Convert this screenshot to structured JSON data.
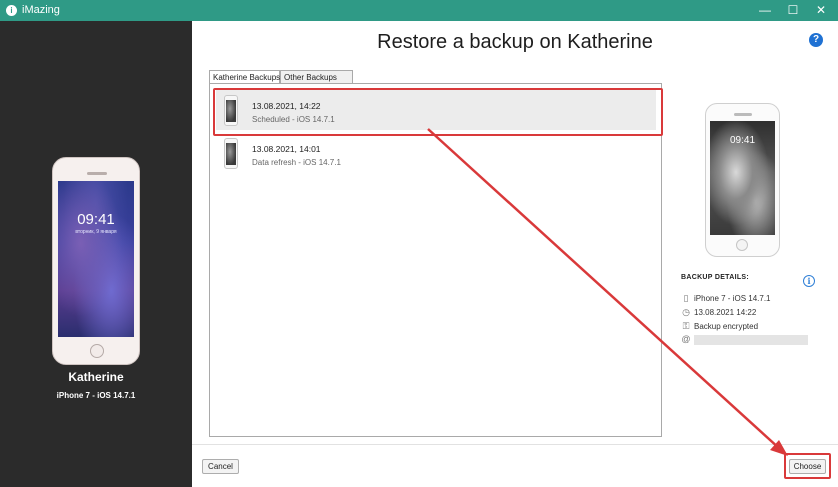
{
  "window": {
    "title": "iMazing",
    "app_icon_glyph": "i",
    "minimize": "—",
    "maximize": "☐",
    "close": "✕"
  },
  "device": {
    "name": "Katherine",
    "info": "iPhone 7 - iOS 14.7.1",
    "lock_time": "09:41",
    "lock_date": "вторник, 9 января"
  },
  "dialog": {
    "title": "Restore a backup on Katherine",
    "help_glyph": "?",
    "tabs": [
      {
        "label": "Katherine Backups",
        "active": true
      },
      {
        "label": "Other Backups",
        "active": false
      }
    ],
    "backups": [
      {
        "date": "13.08.2021, 14:22",
        "subtitle": "Scheduled - iOS 14.7.1",
        "selected": true
      },
      {
        "date": "13.08.2021, 14:01",
        "subtitle": "Data refresh - iOS 14.7.1",
        "selected": false
      }
    ]
  },
  "details": {
    "heading": "BACKUP DETAILS:",
    "info_glyph": "i",
    "phone_time": "09:41",
    "rows": [
      {
        "icon": "phone-icon",
        "glyph": "▯",
        "text": "iPhone 7 - iOS 14.7.1"
      },
      {
        "icon": "clock-icon",
        "glyph": "◷",
        "text": "13.08.2021 14:22"
      },
      {
        "icon": "key-icon",
        "glyph": "⚿",
        "text": "Backup encrypted"
      },
      {
        "icon": "at-icon",
        "glyph": "@",
        "text": ""
      }
    ]
  },
  "buttons": {
    "cancel": "Cancel",
    "choose": "Choose"
  },
  "colors": {
    "titlebar": "#2f9a86",
    "sidebar": "#2b2b2b",
    "highlight": "#d9393a",
    "help_blue": "#1f71d3"
  }
}
